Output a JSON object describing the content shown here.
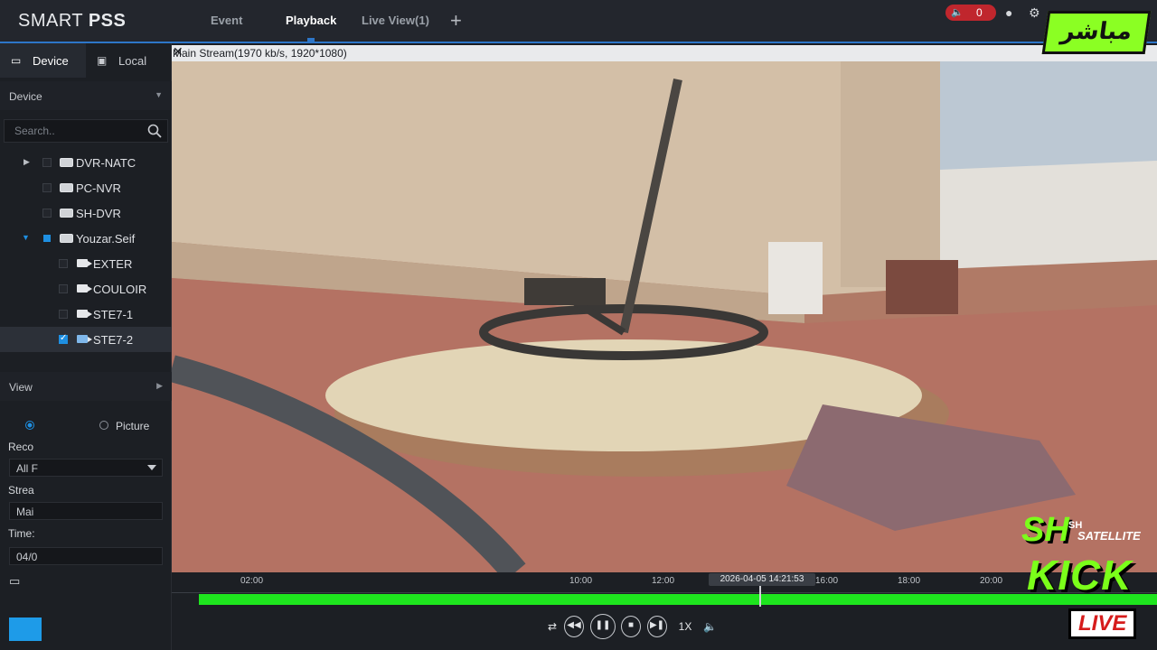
{
  "app": {
    "brand_light": "SMART ",
    "brand_bold": "PSS",
    "tabs": [
      {
        "label": "Event"
      },
      {
        "label": "Playback"
      },
      {
        "label": "Live View(1)"
      }
    ],
    "alarm_count": "0"
  },
  "sidebar": {
    "tabs": [
      {
        "label": "Device"
      },
      {
        "label": "Local"
      }
    ],
    "section_title": "Device",
    "search_placeholder": "Search..",
    "tree": [
      {
        "label": "DVR-NATC"
      },
      {
        "label": "PC-NVR"
      },
      {
        "label": "SH-DVR"
      },
      {
        "label": "Youzar.Seif"
      },
      {
        "label": "EXTER"
      },
      {
        "label": "COULOIR"
      },
      {
        "label": "STE7-1"
      },
      {
        "label": "STE7-2"
      }
    ],
    "view_title": "View",
    "picture_label": "Picture",
    "record_label": "Reco",
    "record_value": "All F",
    "stream_label": "Strea",
    "stream_value": "Mai",
    "time_label": "Time:",
    "time_value": "04/0"
  },
  "video": {
    "stream_info": "Main Stream(1970 kb/s, 1920*1080)"
  },
  "timeline": {
    "ticks": [
      "02:00",
      "10:00",
      "12:00",
      "16:00",
      "18:00",
      "20:00"
    ],
    "current_time": "2026-04-05 14:21:53",
    "speed": "1X"
  },
  "overlays": {
    "live_badge": "مباشر",
    "kick_sh": "SH",
    "kick_sh_small": "SH",
    "kick_satellite": "SATELLITE",
    "kick_word": "KICK",
    "kick_live": "LIVE"
  },
  "colors": {
    "accent": "#2d76c8",
    "record_bar": "#1ee51e",
    "alarm": "#c0262d",
    "kick_green": "#7bff1a"
  }
}
